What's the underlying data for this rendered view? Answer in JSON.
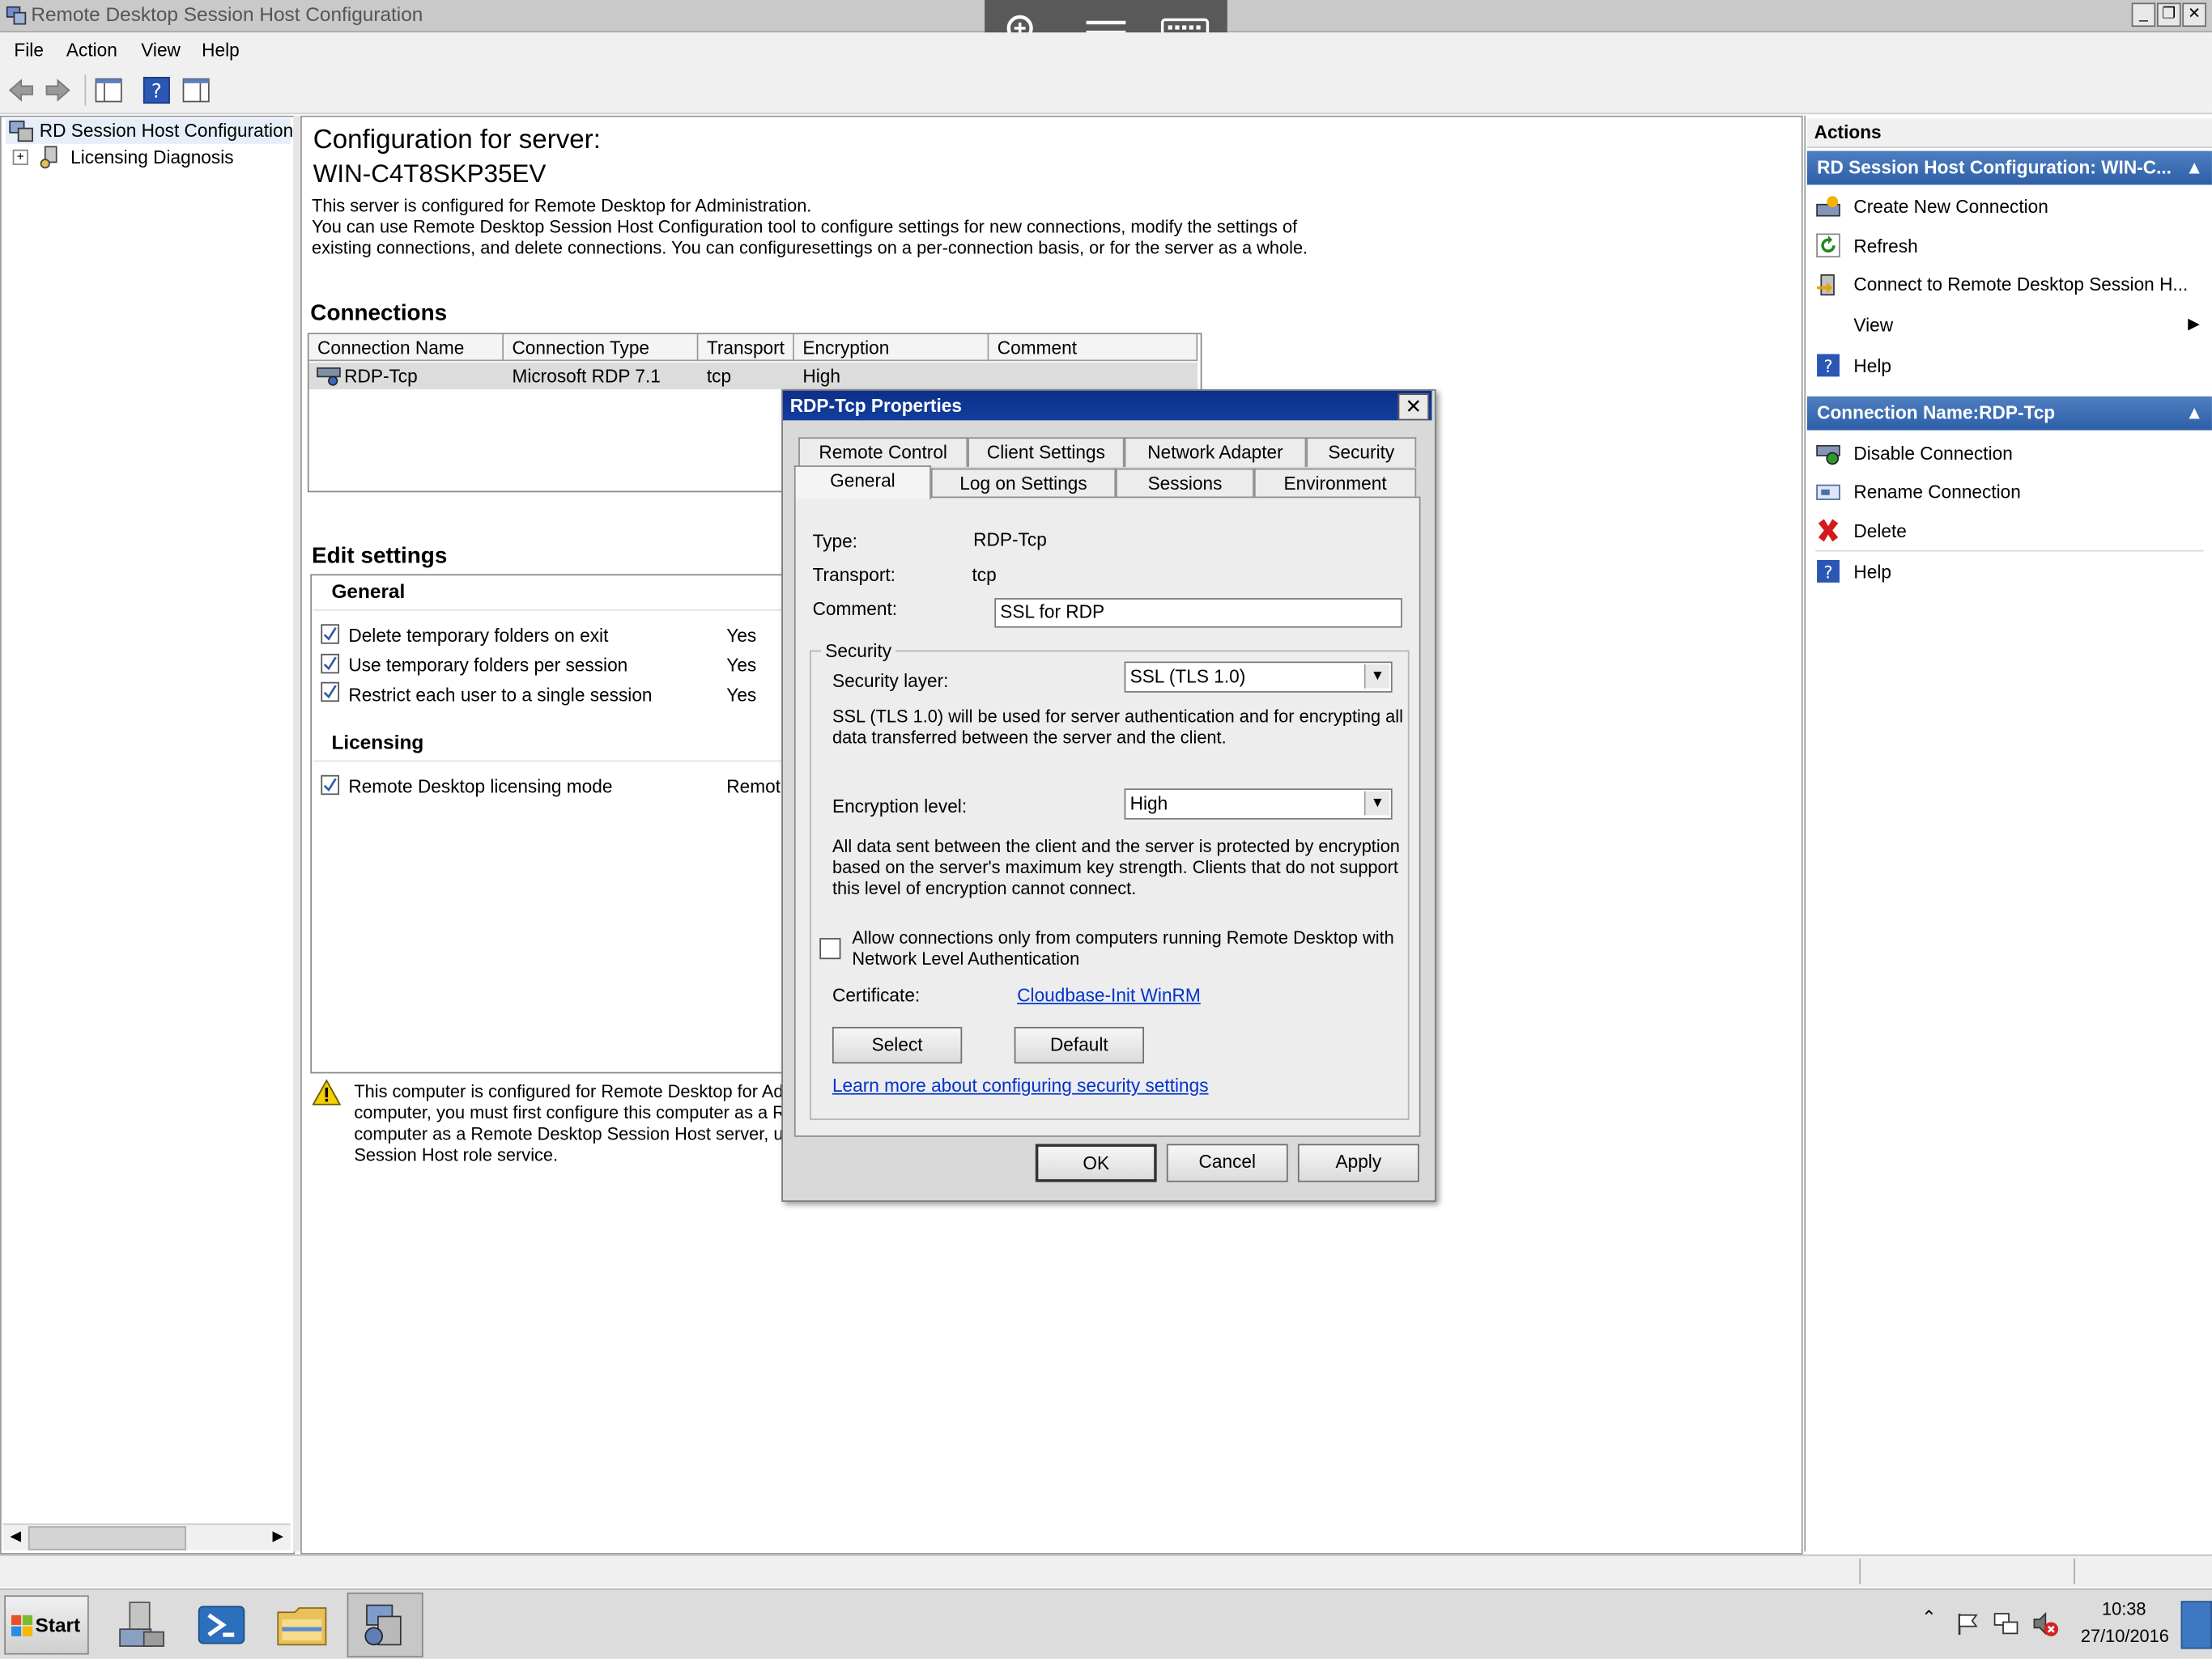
{
  "window": {
    "title": "Remote Desktop Session Host Configuration"
  },
  "remote_toolbar": {
    "zoom": "zoom-icon",
    "menu": "menu-icon",
    "keyboard": "keyboard-icon"
  },
  "menubar": {
    "file": "File",
    "action": "Action",
    "view": "View",
    "help": "Help"
  },
  "tree": {
    "root": "RD Session Host Configuration:",
    "child": "Licensing Diagnosis"
  },
  "main": {
    "title": "Configuration for server:",
    "server_name": "WIN-C4T8SKP35EV",
    "desc_line1": "This server is configured for Remote Desktop for Administration.",
    "desc_line2": "You can use Remote Desktop Session Host Configuration tool to configure settings for new connections, modify the settings of",
    "desc_line3": "existing connections, and delete connections. You can configuresettings on a per-connection basis, or for the server as a whole.",
    "connections_title": "Connections",
    "columns": [
      "Connection Name",
      "Connection Type",
      "Transport",
      "Encryption",
      "Comment"
    ],
    "rows": [
      {
        "name": "RDP-Tcp",
        "type": "Microsoft RDP 7.1",
        "transport": "tcp",
        "encryption": "High",
        "comment": ""
      }
    ],
    "edit_settings_title": "Edit settings",
    "general_title": "General",
    "general_items": [
      {
        "label": "Delete temporary folders on exit",
        "value": "Yes"
      },
      {
        "label": "Use temporary folders per session",
        "value": "Yes"
      },
      {
        "label": "Restrict each user to a single session",
        "value": "Yes"
      }
    ],
    "licensing_title": "Licensing",
    "licensing_items": [
      {
        "label": "Remote Desktop licensing mode",
        "value": "Remote"
      }
    ],
    "warning_line1": "This computer is configured for Remote Desktop for Adn",
    "warning_line2": "computer, you must first configure this computer as a Re",
    "warning_line3": "computer as a Remote Desktop Session Host server, us",
    "warning_line4": "Session Host role service."
  },
  "actions": {
    "title": "Actions",
    "section1": "RD Session Host Configuration: WIN-C...",
    "section1_items": [
      "Create New Connection",
      "Refresh",
      "Connect to Remote Desktop Session H...",
      "View",
      "Help"
    ],
    "section2": "Connection Name:RDP-Tcp",
    "section2_items": [
      "Disable Connection",
      "Rename Connection",
      "Delete",
      "Help"
    ]
  },
  "dialog": {
    "title": "RDP-Tcp Properties",
    "tabs_row1": [
      "Remote Control",
      "Client Settings",
      "Network Adapter",
      "Security"
    ],
    "tabs_row2": [
      "General",
      "Log on Settings",
      "Sessions",
      "Environment"
    ],
    "type_label": "Type:",
    "type_value": "RDP-Tcp",
    "transport_label": "Transport:",
    "transport_value": "tcp",
    "comment_label": "Comment:",
    "comment_value": "SSL for RDP",
    "security_group": "Security",
    "security_layer_label": "Security layer:",
    "security_layer_value": "SSL (TLS 1.0)",
    "security_layer_desc1": "SSL (TLS 1.0) will be used for server authentication and for encrypting all",
    "security_layer_desc2": "data transferred between the server and the client.",
    "encryption_label": "Encryption level:",
    "encryption_value": "High",
    "encryption_desc1": "All data sent between the client and the server is protected by encryption",
    "encryption_desc2": "based on the server's maximum key strength. Clients that do not support",
    "encryption_desc3": "this level of encryption cannot connect.",
    "nla_line1": "Allow connections only from computers running Remote Desktop with",
    "nla_line2": "Network Level Authentication",
    "nla_checked": false,
    "certificate_label": "Certificate:",
    "certificate_value": "Cloudbase-Init WinRM",
    "select_btn": "Select",
    "default_btn": "Default",
    "learn_more": "Learn more about configuring security settings",
    "ok": "OK",
    "cancel": "Cancel",
    "apply": "Apply"
  },
  "taskbar": {
    "start": "Start",
    "time": "10:38",
    "date": "27/10/2016"
  }
}
